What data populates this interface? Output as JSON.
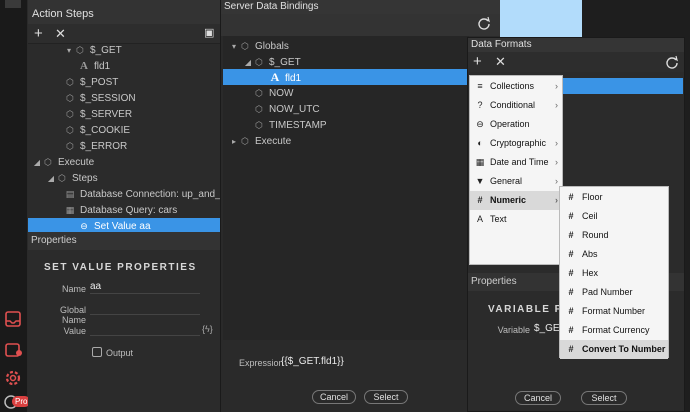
{
  "action_steps": {
    "title": "Action Steps",
    "tree": [
      {
        "label": "$_GET",
        "icon": "cube-icon",
        "arrow": "▾"
      },
      {
        "label": "fld1",
        "icon": "text-icon"
      },
      {
        "label": "$_POST",
        "icon": "cube-icon"
      },
      {
        "label": "$_SESSION",
        "icon": "cube-icon"
      },
      {
        "label": "$_SERVER",
        "icon": "cube-icon"
      },
      {
        "label": "$_COOKIE",
        "icon": "cube-icon"
      },
      {
        "label": "$_ERROR",
        "icon": "cube-icon"
      },
      {
        "label": "Execute",
        "icon": "cube-icon",
        "arrow": "◢"
      },
      {
        "label": "Steps",
        "icon": "cube-icon",
        "arrow": "◢"
      },
      {
        "label": "Database Connection: up_and_runnir",
        "icon": "database-icon"
      },
      {
        "label": "Database Query: cars",
        "icon": "table-icon"
      },
      {
        "label": "Set Value aa",
        "icon": "set-value-icon",
        "selected": true
      }
    ],
    "properties_header": "Properties",
    "properties_title": "SET VALUE PROPERTIES",
    "name_label": "Name",
    "name_value": "aa",
    "global_name_label": "Global Name",
    "value_label": "Value",
    "output_label": "Output"
  },
  "sdb": {
    "title": "Server Data Bindings",
    "tree": [
      {
        "label": "Globals",
        "arrow": "▾"
      },
      {
        "label": "$_GET",
        "arrow": "◢"
      },
      {
        "label": "fld1",
        "selected": true
      },
      {
        "label": "NOW"
      },
      {
        "label": "NOW_UTC"
      },
      {
        "label": "TIMESTAMP"
      },
      {
        "label": "Execute",
        "arrow": "▸"
      }
    ],
    "expression_label": "Expression",
    "expression_value": "{{$_GET.fld1}}",
    "cancel": "Cancel",
    "select": "Select"
  },
  "df": {
    "title": "Data Formats",
    "categories": [
      {
        "label": "Collections",
        "icon": "≡"
      },
      {
        "label": "Conditional",
        "icon": "?"
      },
      {
        "label": "Operation",
        "icon": "⊖"
      },
      {
        "label": "Cryptographic",
        "icon": "◐"
      },
      {
        "label": "Date and Time",
        "icon": "▦"
      },
      {
        "label": "General",
        "icon": "▼"
      },
      {
        "label": "Numeric",
        "icon": "#",
        "active": true
      },
      {
        "label": "Text",
        "icon": "A"
      }
    ],
    "numeric": [
      "Floor",
      "Ceil",
      "Round",
      "Abs",
      "Hex",
      "Pad Number",
      "Format Number",
      "Format Currency",
      "Convert To Number"
    ],
    "properties_header": "Properties",
    "variable_props_title": "VARIABLE PRO",
    "variable_label": "Variable",
    "variable_value": "$_GET.",
    "cancel": "Cancel",
    "select": "Select"
  },
  "colors": {
    "accent": "#3a94e6",
    "light_blue": "#b2dcfb",
    "badge_red": "#d94040"
  },
  "left_strip": {
    "pro_badge": "Pro"
  }
}
